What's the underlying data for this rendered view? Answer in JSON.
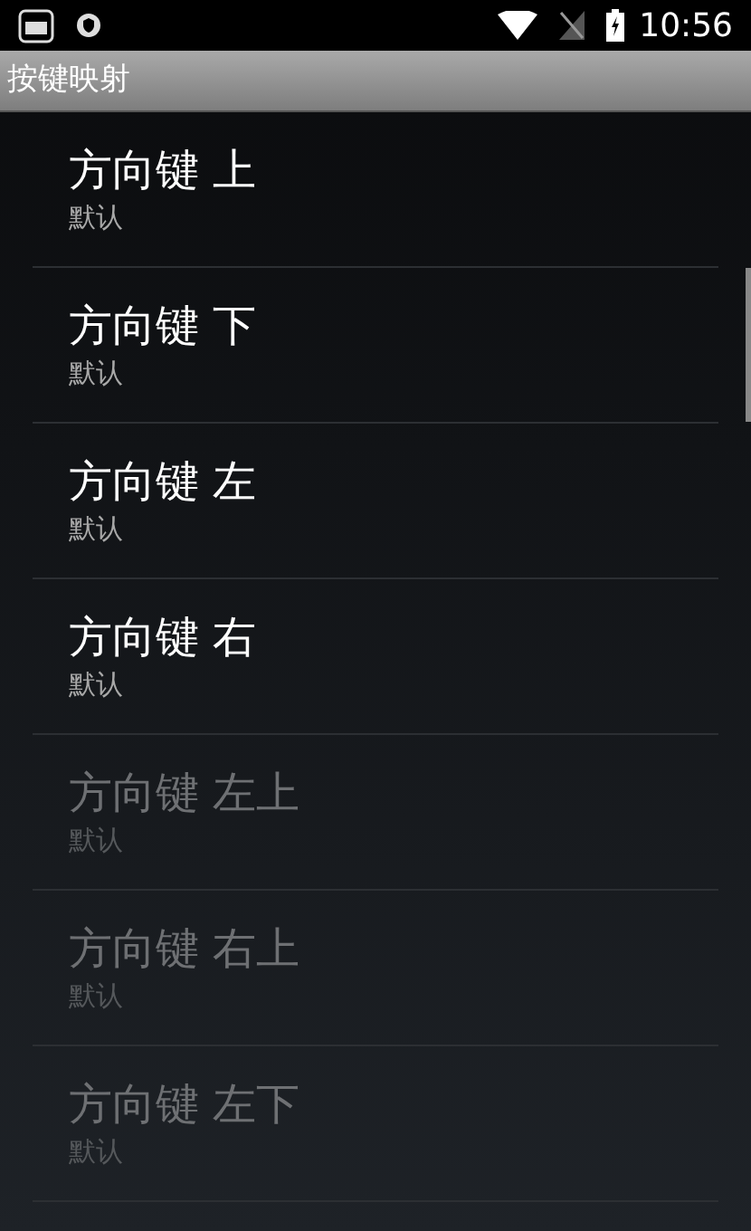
{
  "status_bar": {
    "time": "10:56"
  },
  "title_bar": {
    "title": "按键映射"
  },
  "items": [
    {
      "title": "方向键 上",
      "summary": "默认",
      "disabled": false
    },
    {
      "title": "方向键 下",
      "summary": "默认",
      "disabled": false
    },
    {
      "title": "方向键 左",
      "summary": "默认",
      "disabled": false
    },
    {
      "title": "方向键 右",
      "summary": "默认",
      "disabled": false
    },
    {
      "title": "方向键 左上",
      "summary": "默认",
      "disabled": true
    },
    {
      "title": "方向键 右上",
      "summary": "默认",
      "disabled": true
    },
    {
      "title": "方向键 左下",
      "summary": "默认",
      "disabled": true
    }
  ]
}
